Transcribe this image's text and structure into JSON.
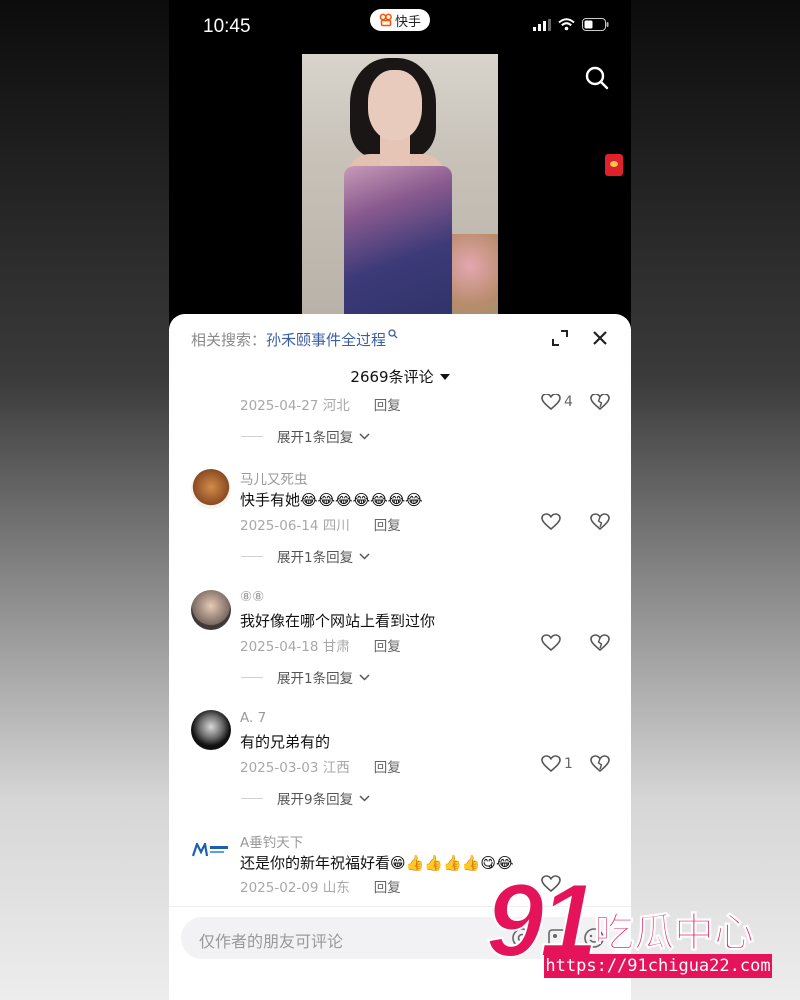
{
  "status_bar": {
    "time": "10:45",
    "app_name": "快手"
  },
  "sheet_header": {
    "related_prefix": "相关搜索：",
    "related_query": "孙禾颐事件全过程",
    "comment_count_label": "2669条评论"
  },
  "comments": [
    {
      "meta_date": "2025-04-27 河北",
      "reply_label": "回复",
      "likes": "4",
      "expand_label": "展开1条回复"
    },
    {
      "name": "马儿又死虫",
      "text": "快手有她😂😂😂😂😂😂😂",
      "meta_date": "2025-06-14 四川",
      "reply_label": "回复",
      "likes": "",
      "expand_label": "展开1条回复"
    },
    {
      "name": "⑧⑧",
      "text": "我好像在哪个网站上看到过你",
      "meta_date": "2025-04-18 甘肃",
      "reply_label": "回复",
      "likes": "",
      "expand_label": "展开1条回复"
    },
    {
      "name": "A. 7",
      "text": "有的兄弟有的",
      "meta_date": "2025-03-03 江西",
      "reply_label": "回复",
      "likes": "1",
      "expand_label": "展开9条回复"
    },
    {
      "name": "A垂钓天下",
      "text": "还是你的新年祝福好看😁👍👍👍👍😋😂",
      "meta_date": "2025-02-09 山东",
      "reply_label": "回复",
      "likes": ""
    }
  ],
  "input_bar": {
    "placeholder": "仅作者的朋友可评论"
  },
  "watermark": {
    "number": "91",
    "brand": "吃瓜中心",
    "url": "https://91chigua22.com"
  },
  "colors": {
    "link": "#3a5ea6",
    "watermark": "#e4135a",
    "redpack": "#e0212c"
  }
}
